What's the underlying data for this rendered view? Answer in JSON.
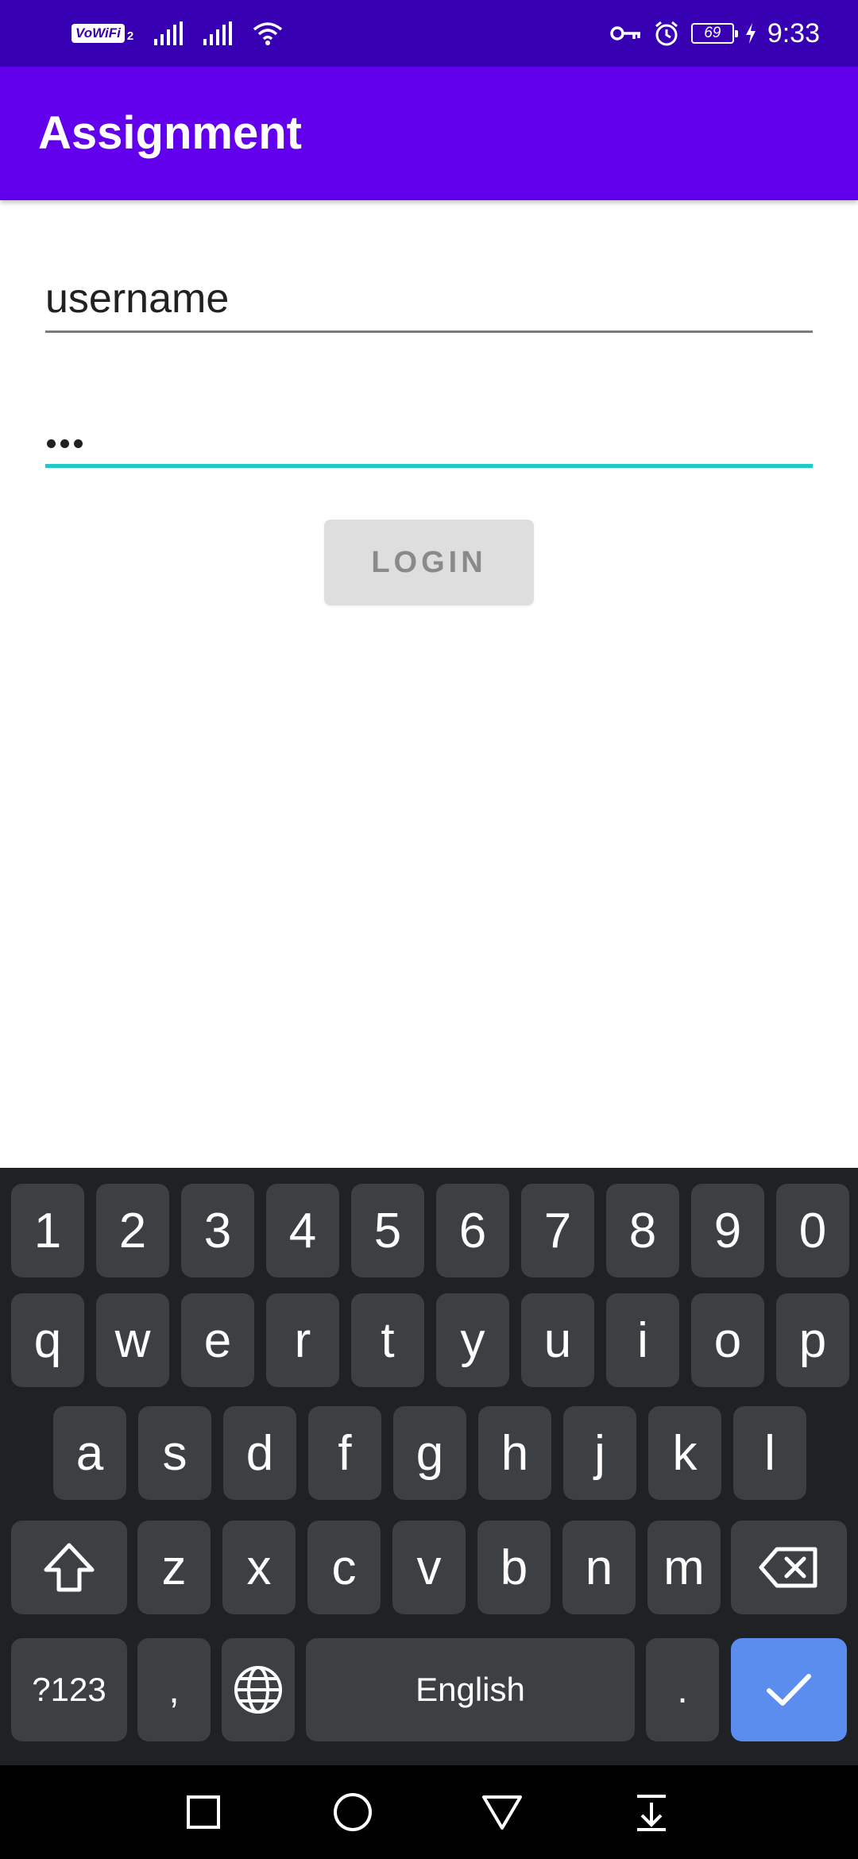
{
  "status_bar": {
    "network_badge": "VoWiFi",
    "sim_badge": "2",
    "battery_level": "69",
    "time": "9:33",
    "icons": [
      "vowifi-icon",
      "signal-icon",
      "signal-icon",
      "wifi-icon",
      "vpn-key-icon",
      "alarm-icon",
      "battery-icon",
      "charging-icon"
    ]
  },
  "app_bar": {
    "title": "Assignment"
  },
  "form": {
    "username_value": "username",
    "password_value": "•••",
    "login_label": "LOGIN",
    "focus_color": "#1fc9c4"
  },
  "keyboard": {
    "row_numbers": [
      "1",
      "2",
      "3",
      "4",
      "5",
      "6",
      "7",
      "8",
      "9",
      "0"
    ],
    "row1": [
      "q",
      "w",
      "e",
      "r",
      "t",
      "y",
      "u",
      "i",
      "o",
      "p"
    ],
    "row2": [
      "a",
      "s",
      "d",
      "f",
      "g",
      "h",
      "j",
      "k",
      "l"
    ],
    "row3": [
      "z",
      "x",
      "c",
      "v",
      "b",
      "n",
      "m"
    ],
    "symbols_label": "?123",
    "comma": ",",
    "space_label": "English",
    "period": ".",
    "enter_color": "#5b8def"
  },
  "nav_bar": {
    "icons": [
      "recents-square-icon",
      "home-circle-icon",
      "back-triangle-icon",
      "notifications-pulldown-icon"
    ]
  },
  "colors": {
    "status_bar": "#3700b3",
    "app_bar": "#6200ee",
    "keyboard_bg": "#202124",
    "key_bg": "#3c4043"
  }
}
